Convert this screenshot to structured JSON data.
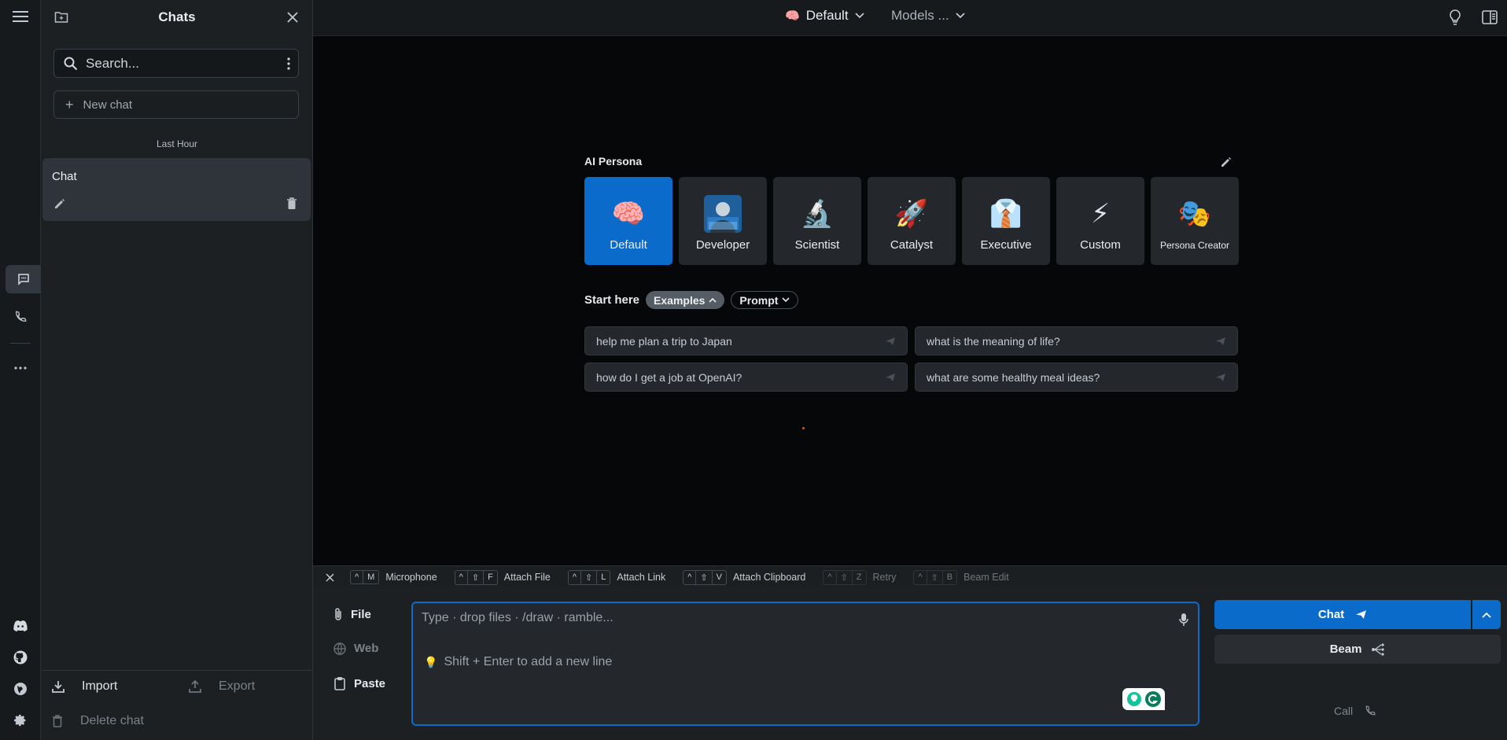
{
  "sidebar": {
    "title": "Chats",
    "search_placeholder": "Search...",
    "new_chat": "New chat",
    "group_label": "Last Hour",
    "chat_item": "Chat",
    "import": "Import",
    "export": "Export",
    "delete_chat": "Delete chat"
  },
  "topbar": {
    "persona_select": "Default",
    "models_select": "Models ..."
  },
  "persona_panel": {
    "title": "AI Persona",
    "personas": [
      {
        "label": "Default",
        "icon": "brain-icon",
        "active": true
      },
      {
        "label": "Developer",
        "icon": "developer-avatar-icon",
        "active": false
      },
      {
        "label": "Scientist",
        "icon": "microscope-icon",
        "active": false
      },
      {
        "label": "Catalyst",
        "icon": "rocket-icon",
        "active": false
      },
      {
        "label": "Executive",
        "icon": "suit-icon",
        "active": false
      },
      {
        "label": "Custom",
        "icon": "lightning-icon",
        "active": false
      },
      {
        "label": "Persona Creator",
        "icon": "theater-masks-icon",
        "active": false
      }
    ],
    "start_here": "Start here",
    "examples_chip": "Examples",
    "prompt_chip": "Prompt",
    "examples": [
      "help me plan a trip to Japan",
      "what is the meaning of life?",
      "how do I get a job at OpenAI?",
      "what are some healthy meal ideas?"
    ]
  },
  "shortcuts": [
    {
      "keys": [
        "^",
        "M"
      ],
      "label": "Microphone",
      "dim": false
    },
    {
      "keys": [
        "^",
        "⇧",
        "F"
      ],
      "label": "Attach File",
      "dim": false
    },
    {
      "keys": [
        "^",
        "⇧",
        "L"
      ],
      "label": "Attach Link",
      "dim": false
    },
    {
      "keys": [
        "^",
        "⇧",
        "V"
      ],
      "label": "Attach Clipboard",
      "dim": false
    },
    {
      "keys": [
        "^",
        "⇧",
        "Z"
      ],
      "label": "Retry",
      "dim": true
    },
    {
      "keys": [
        "^",
        "⇧",
        "B"
      ],
      "label": "Beam Edit",
      "dim": true
    }
  ],
  "composer": {
    "file": "File",
    "web": "Web",
    "paste": "Paste",
    "placeholder": "Type · drop files · /draw · ramble...",
    "hint": "Shift + Enter to add a new line",
    "chat_button": "Chat",
    "beam_button": "Beam",
    "call": "Call"
  },
  "colors": {
    "accent": "#0b6bcb",
    "background": "#060708",
    "sidebar": "#1d2023"
  }
}
